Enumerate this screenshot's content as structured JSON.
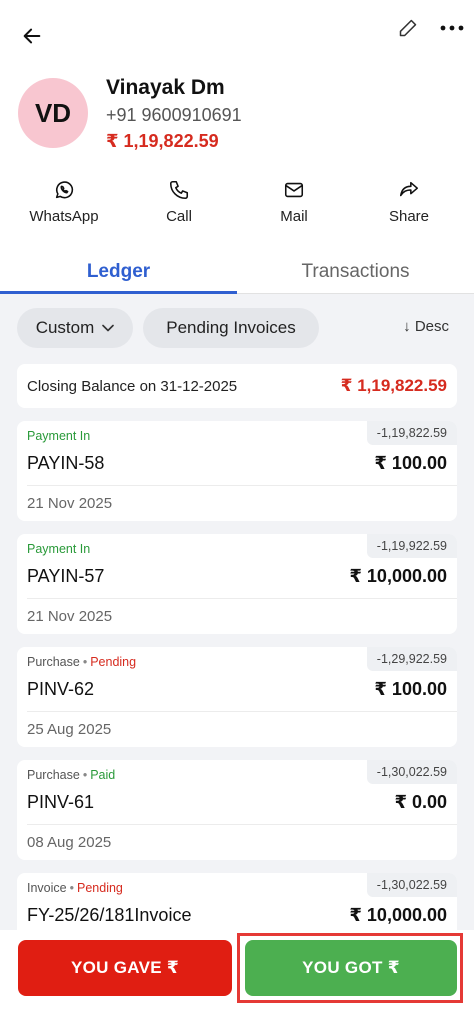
{
  "header": {
    "back_icon": "arrow-left-icon",
    "edit_icon": "pencil-icon",
    "more_icon": "more-horizontal-icon"
  },
  "profile": {
    "initials": "VD",
    "name": "Vinayak Dm",
    "phone": "+91 9600910691",
    "balance": "₹ 1,19,822.59",
    "avatar_color": "#f8c6d0",
    "balance_color": "#d62b1f"
  },
  "actions": [
    {
      "label": "WhatsApp",
      "icon": "whatsapp-icon"
    },
    {
      "label": "Call",
      "icon": "phone-icon"
    },
    {
      "label": "Mail",
      "icon": "mail-icon"
    },
    {
      "label": "Share",
      "icon": "share-icon"
    }
  ],
  "tabs": [
    {
      "label": "Ledger",
      "active": true
    },
    {
      "label": "Transactions",
      "active": false
    }
  ],
  "filters": {
    "period": "Custom",
    "pending_invoices": "Pending Invoices",
    "sort": "↓ Desc"
  },
  "closing": {
    "label": "Closing Balance on 31-12-2025",
    "value": "₹ 1,19,822.59"
  },
  "entries": [
    {
      "type": "Payment In",
      "status": "",
      "running_balance": "-1,19,822.59",
      "doc": "PAYIN-58",
      "amount": "₹ 100.00",
      "date": "21 Nov 2025"
    },
    {
      "type": "Payment In",
      "status": "",
      "running_balance": "-1,19,922.59",
      "doc": "PAYIN-57",
      "amount": "₹ 10,000.00",
      "date": "21 Nov 2025"
    },
    {
      "type": "Purchase",
      "status": "Pending",
      "running_balance": "-1,29,922.59",
      "doc": "PINV-62",
      "amount": "₹ 100.00",
      "date": "25 Aug 2025"
    },
    {
      "type": "Purchase",
      "status": "Paid",
      "running_balance": "-1,30,022.59",
      "doc": "PINV-61",
      "amount": "₹ 0.00",
      "date": "08 Aug 2025"
    },
    {
      "type": "Invoice",
      "status": "Pending",
      "running_balance": "-1,30,022.59",
      "doc": "FY-25/26/181Invoice",
      "amount": "₹ 10,000.00",
      "date": ""
    }
  ],
  "bottom": {
    "gave_label": "YOU GAVE ₹",
    "got_label": "YOU GOT ₹",
    "gave_color": "#e01e12",
    "got_color": "#4caf50"
  },
  "colors": {
    "accent": "#2f5fd0",
    "pending": "#d62b1f",
    "positive": "#2a9a3a"
  }
}
